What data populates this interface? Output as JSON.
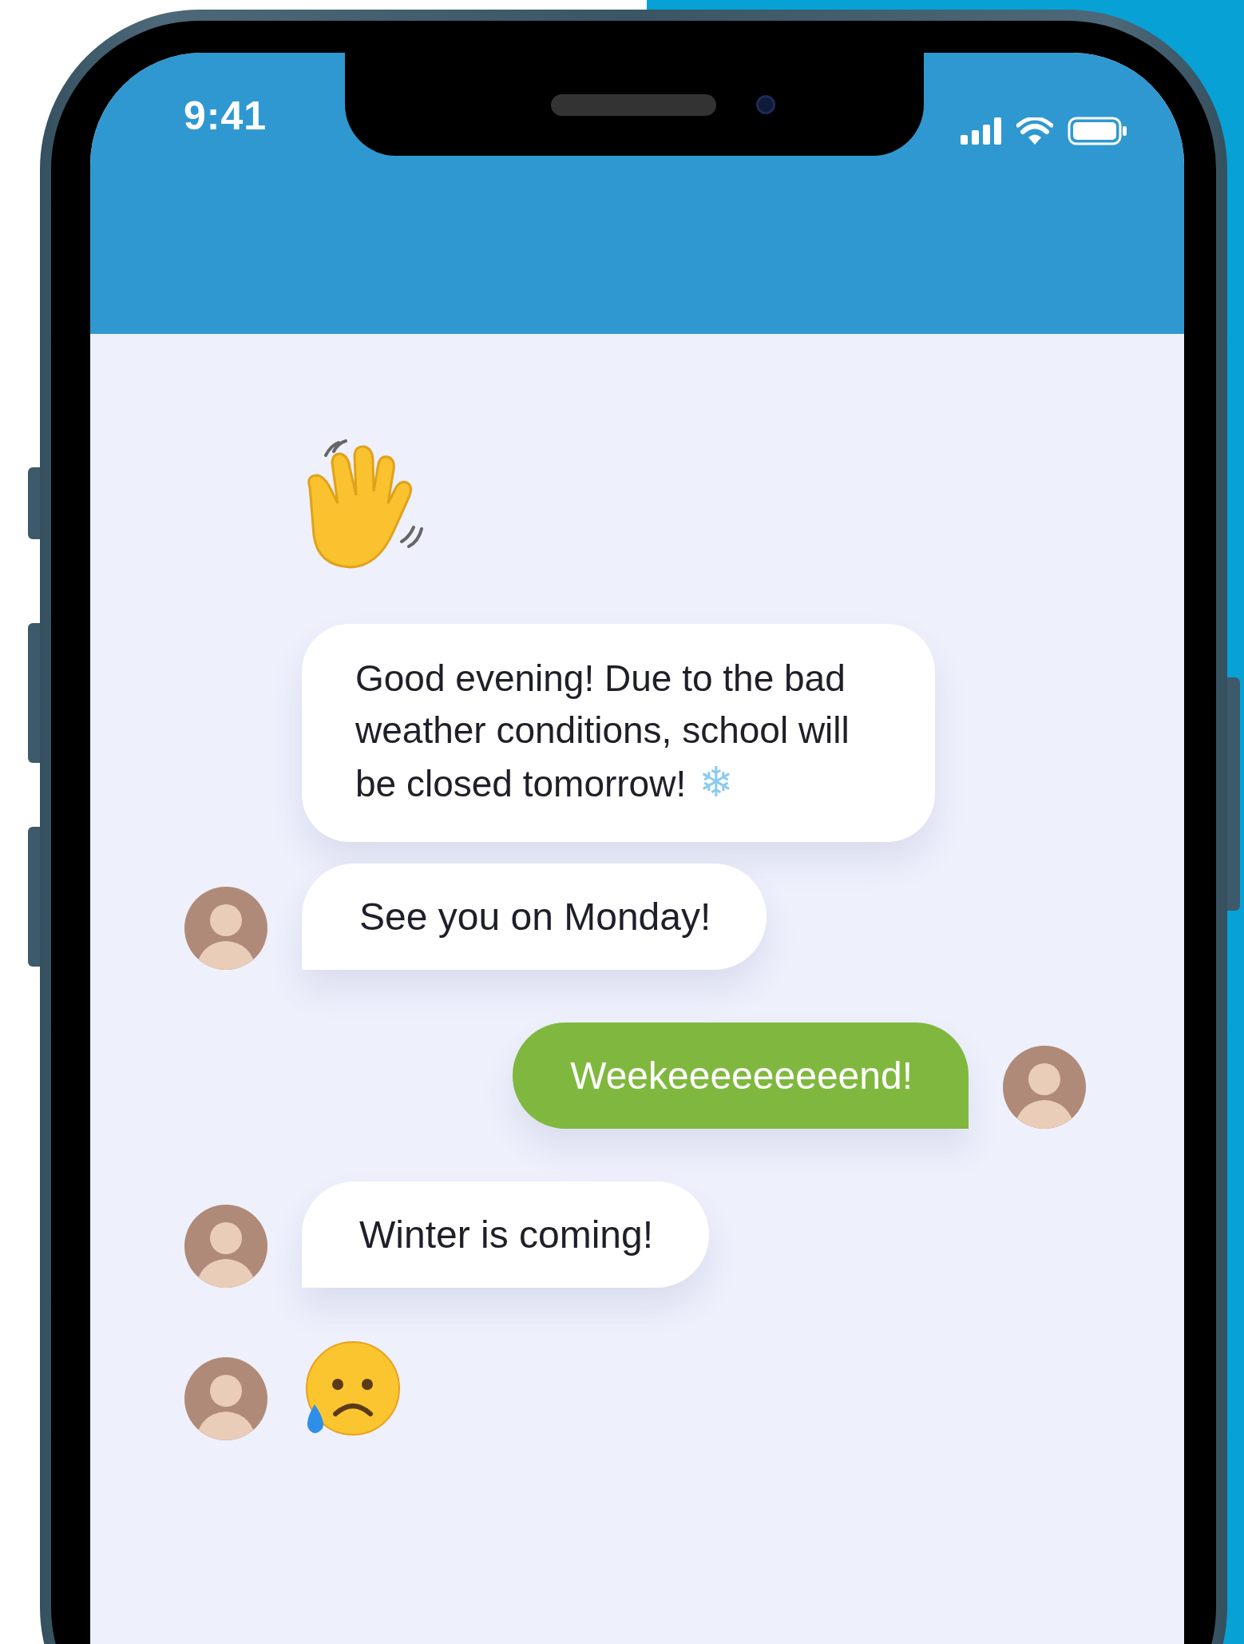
{
  "status_bar": {
    "time": "9:41"
  },
  "messages": [
    {
      "kind": "wave",
      "outgoing": false
    },
    {
      "kind": "text",
      "text": "Good evening! Due to the bad weather conditions, school will be closed tomorrow!",
      "snowflake": "❄",
      "outgoing": false,
      "avatar": false
    },
    {
      "kind": "text",
      "text": "See you on Monday!",
      "outgoing": false,
      "avatar": true
    },
    {
      "kind": "text",
      "text": "Weekeeeeeeeeend!",
      "outgoing": true,
      "avatar": true
    },
    {
      "kind": "text",
      "text": "Winter is coming!",
      "outgoing": false,
      "avatar": true
    },
    {
      "kind": "sad",
      "outgoing": false,
      "avatar": true
    }
  ]
}
